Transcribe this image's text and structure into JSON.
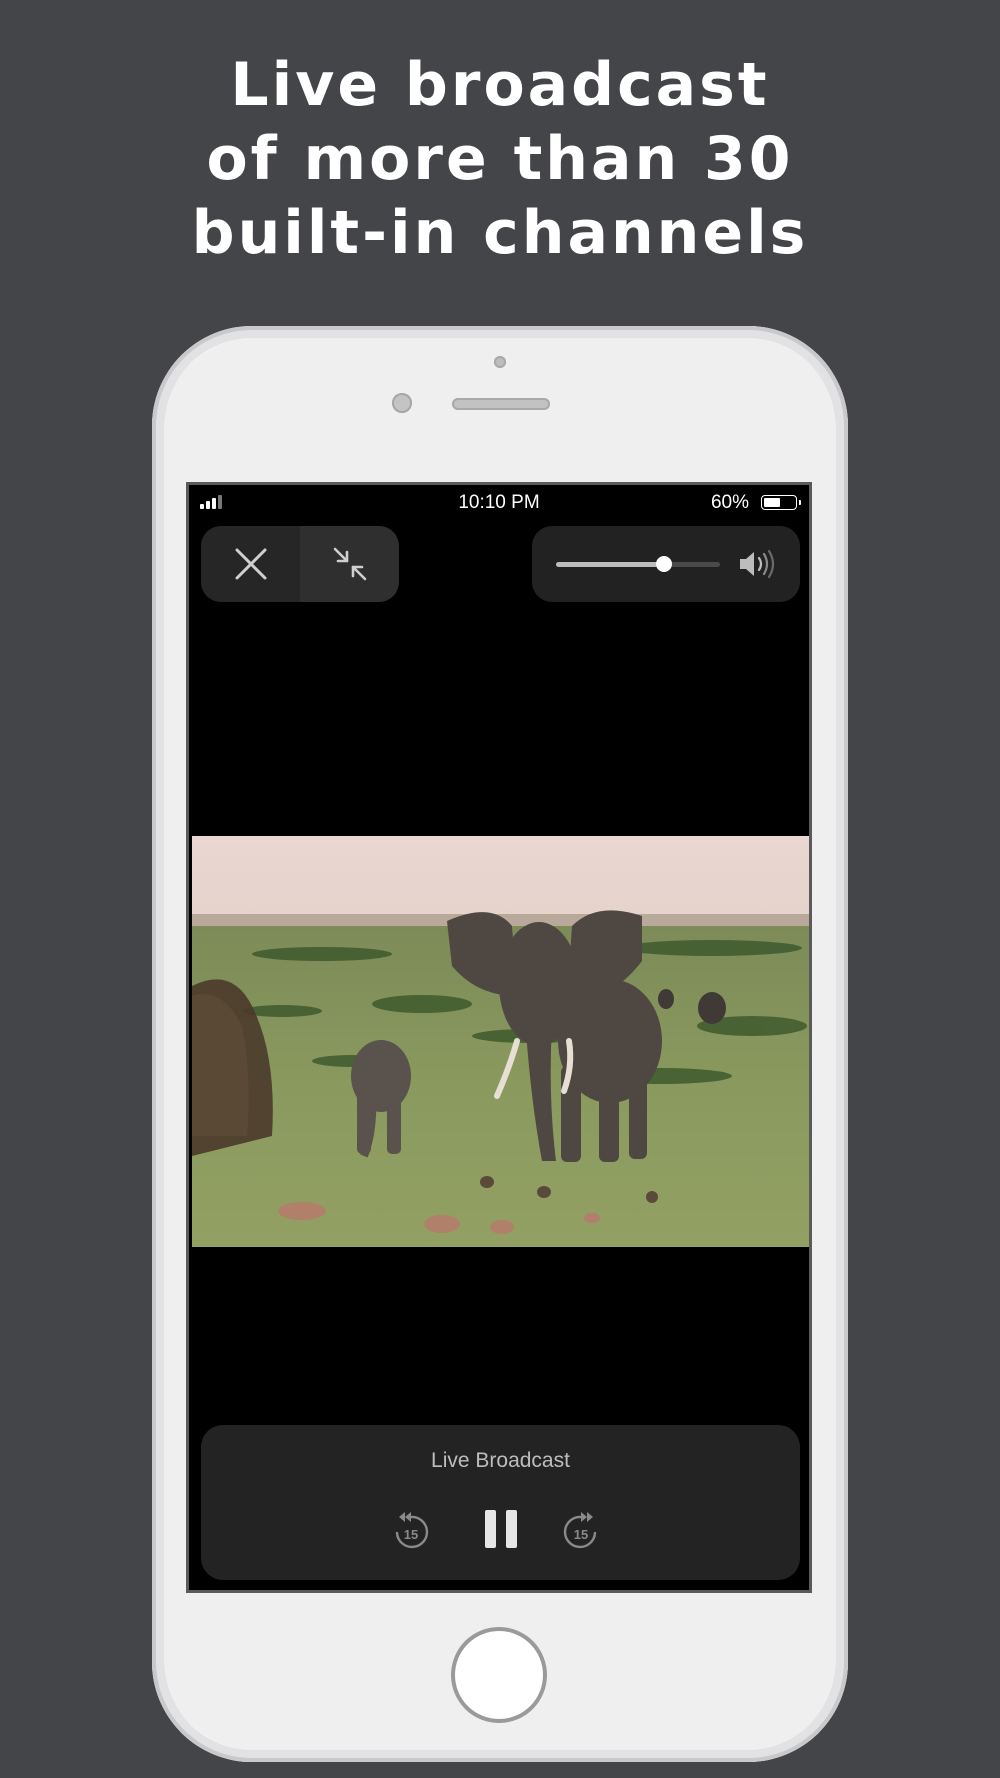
{
  "headline": {
    "line1": "Live broadcast",
    "line2": "of more than 30",
    "line3": "built-in channels"
  },
  "status_bar": {
    "time": "10:10 PM",
    "battery_percent_label": "60%",
    "battery_level": 0.6,
    "signal_bars": 3
  },
  "top_controls": {
    "close_icon": "close-icon",
    "exit_fullscreen_icon": "arrows-in-icon",
    "volume_level": 0.66,
    "volume_icon": "speaker-volume-icon"
  },
  "video": {
    "scene": "elephant-savanna-frame"
  },
  "playback": {
    "title": "Live Broadcast",
    "rewind_label": "15",
    "forward_label": "15",
    "pause_icon": "pause-icon"
  },
  "colors": {
    "background": "#444549",
    "panel": "#232324",
    "text": "#ffffff"
  }
}
